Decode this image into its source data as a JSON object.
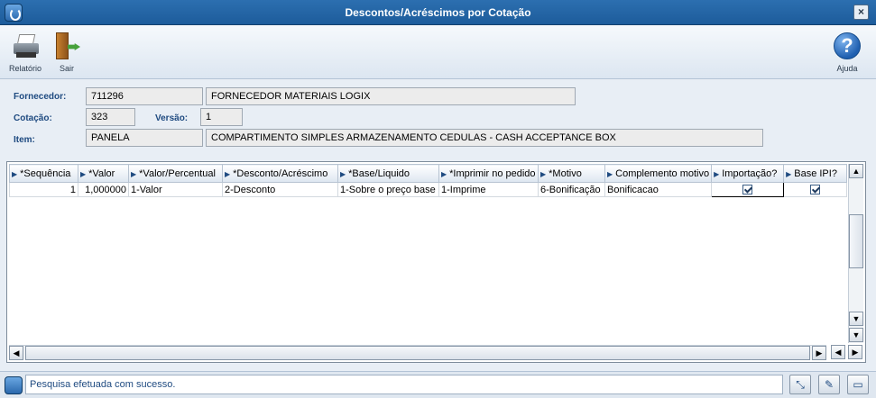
{
  "window": {
    "title": "Descontos/Acréscimos por Cotação",
    "close_label": "×"
  },
  "toolbar": {
    "report_label": "Relatório",
    "exit_label": "Sair",
    "help_label": "Ajuda",
    "help_glyph": "?"
  },
  "form": {
    "fornecedor_label": "Fornecedor:",
    "fornecedor_code": "711296",
    "fornecedor_name": "FORNECEDOR MATERIAIS LOGIX",
    "cotacao_label": "Cotação:",
    "cotacao_value": "323",
    "versao_label": "Versão:",
    "versao_value": "1",
    "item_label": "Item:",
    "item_code": "PANELA",
    "item_desc": "COMPARTIMENTO SIMPLES ARMAZENAMENTO CEDULAS - CASH ACCEPTANCE BOX"
  },
  "grid": {
    "columns": [
      "*Sequência",
      "*Valor",
      "*Valor/Percentual",
      "*Desconto/Acréscimo",
      "*Base/Liquido",
      "*Imprimir no pedido",
      "*Motivo",
      "Complemento motivo",
      "Importação?",
      "Base IPI?"
    ],
    "rows": [
      {
        "sequencia": "1",
        "valor": "1,000000",
        "valor_percentual": "1-Valor",
        "desconto_acrescimo": "2-Desconto",
        "base_liquido": "1-Sobre o preço base",
        "imprimir": "1-Imprime",
        "motivo": "6-Bonificação",
        "complemento": "Bonificacao",
        "importacao": true,
        "base_ipi": true
      }
    ]
  },
  "status": {
    "message": "Pesquisa efetuada com sucesso."
  },
  "icons": [
    "printer-icon",
    "exit-door-icon",
    "help-icon",
    "app-logo-icon",
    "checkbox-icon"
  ],
  "colors": {
    "titlebar": "#1d5c9b",
    "label": "#1e4a80",
    "background": "#e8eef5"
  }
}
